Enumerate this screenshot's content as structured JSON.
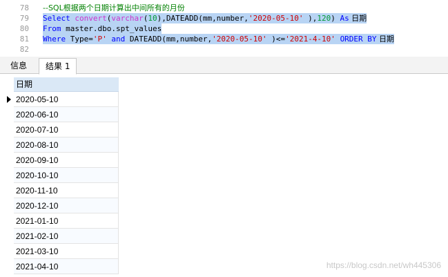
{
  "editor": {
    "lines": [
      {
        "num": "78",
        "text": "--SQL根据两个日期计算出中间所有的月份"
      },
      {
        "num": "79",
        "kw1": "Select",
        "fn": " convert",
        "p1": "(",
        "kw2": "varchar",
        "p2": "(",
        "n1": "10",
        "p3": "),DATEADD(mm,number,",
        "s1": "'2020-05-10'",
        "p4": " ),",
        "n2": "120",
        "p5": ") ",
        "kw3": "As",
        "p6": " 日期"
      },
      {
        "num": "80",
        "kw1": "From",
        "p1": " master.dbo.spt_values"
      },
      {
        "num": "81",
        "kw1": "Where",
        "p1": " Type=",
        "s1": "'P'",
        "p2": " ",
        "kw2": "and",
        "p3": " DATEADD(mm,number,",
        "s2": "'2020-05-10'",
        "p4": " )<=",
        "s3": "'2021-4-10'",
        "p5": " ",
        "kw3": "ORDER BY",
        "p6": " 日期"
      },
      {
        "num": "82",
        "text": ""
      }
    ]
  },
  "tabs": {
    "info_label": "信息",
    "result_label": "结果 1"
  },
  "grid": {
    "column_header": "日期",
    "rows": [
      "2020-05-10",
      "2020-06-10",
      "2020-07-10",
      "2020-08-10",
      "2020-09-10",
      "2020-10-10",
      "2020-11-10",
      "2020-12-10",
      "2021-01-10",
      "2021-02-10",
      "2021-03-10",
      "2021-04-10"
    ]
  },
  "watermark": "https://blog.csdn.net/wh445306"
}
